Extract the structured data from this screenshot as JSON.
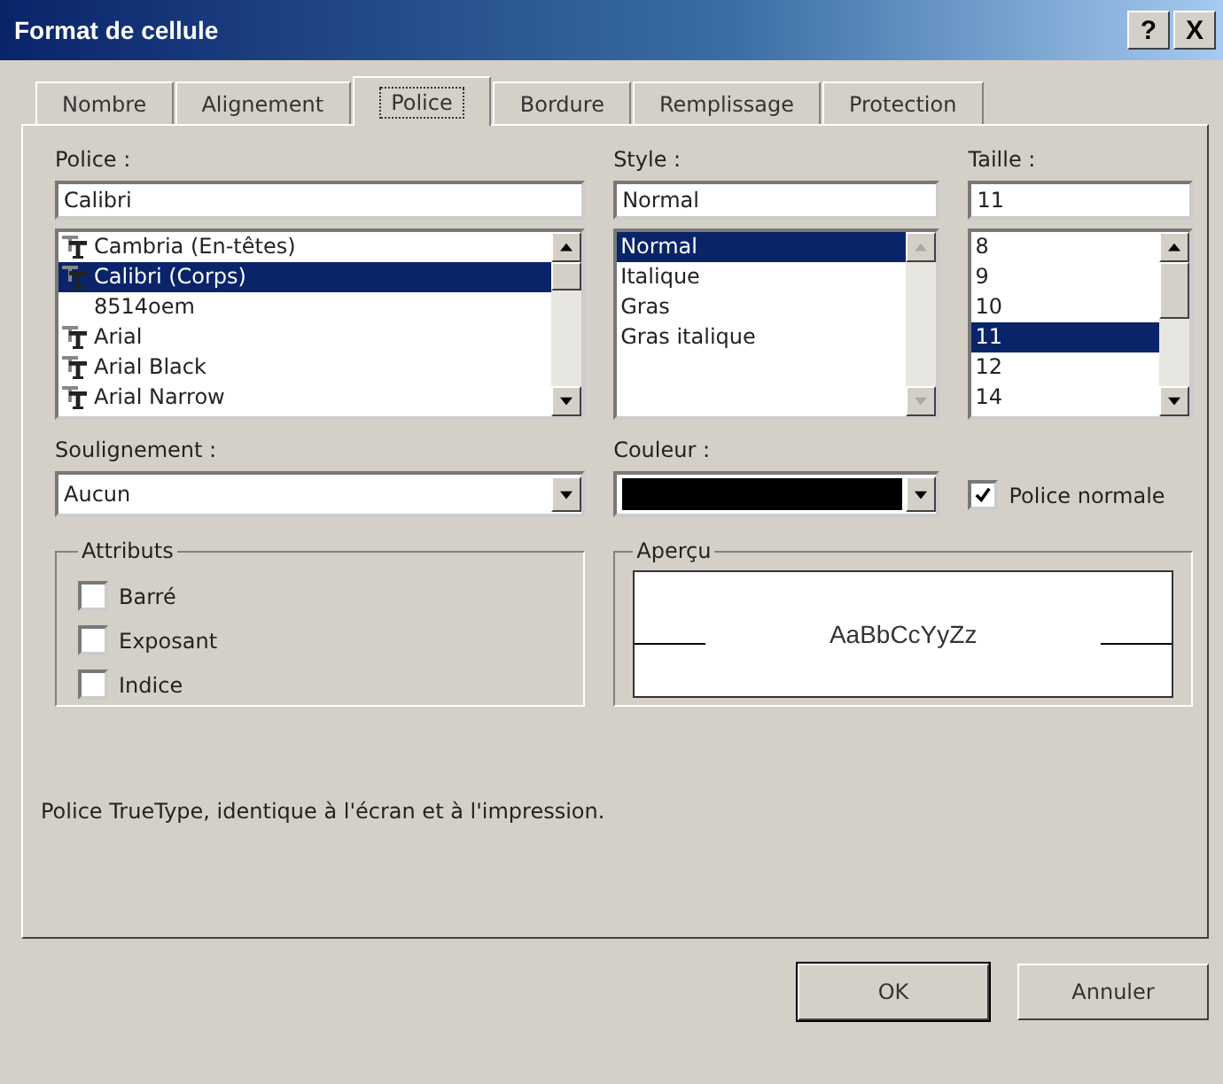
{
  "window": {
    "title": "Format de cellule",
    "help": "?",
    "close": "X"
  },
  "tabs": [
    {
      "label": "Nombre",
      "selected": false
    },
    {
      "label": "Alignement",
      "selected": false
    },
    {
      "label": "Police",
      "selected": true
    },
    {
      "label": "Bordure",
      "selected": false
    },
    {
      "label": "Remplissage",
      "selected": false
    },
    {
      "label": "Protection",
      "selected": false
    }
  ],
  "font": {
    "label": "Police :",
    "value": "Calibri",
    "items": [
      {
        "name": "Cambria (En-têtes)",
        "truetype": true,
        "selected": false
      },
      {
        "name": "Calibri (Corps)",
        "truetype": true,
        "selected": true
      },
      {
        "name": "8514oem",
        "truetype": false,
        "selected": false
      },
      {
        "name": "Arial",
        "truetype": true,
        "selected": false
      },
      {
        "name": "Arial Black",
        "truetype": true,
        "selected": false
      },
      {
        "name": "Arial Narrow",
        "truetype": true,
        "selected": false
      }
    ]
  },
  "style": {
    "label": "Style :",
    "value": "Normal",
    "items": [
      {
        "name": "Normal",
        "selected": true
      },
      {
        "name": "Italique",
        "selected": false
      },
      {
        "name": "Gras",
        "selected": false
      },
      {
        "name": "Gras italique",
        "selected": false
      }
    ]
  },
  "size": {
    "label": "Taille :",
    "value": "11",
    "items": [
      {
        "name": "8",
        "selected": false
      },
      {
        "name": "9",
        "selected": false
      },
      {
        "name": "10",
        "selected": false
      },
      {
        "name": "11",
        "selected": true
      },
      {
        "name": "12",
        "selected": false
      },
      {
        "name": "14",
        "selected": false
      }
    ]
  },
  "underline": {
    "label": "Soulignement :",
    "value": "Aucun"
  },
  "color": {
    "label": "Couleur :",
    "color": "#000000"
  },
  "normal_font": {
    "label": "Police normale",
    "checked": true
  },
  "attributes": {
    "title": "Attributs",
    "items": [
      {
        "label": "Barré",
        "checked": false
      },
      {
        "label": "Exposant",
        "checked": false
      },
      {
        "label": "Indice",
        "checked": false
      }
    ]
  },
  "preview": {
    "title": "Aperçu",
    "sample": "AaBbCcYyZz"
  },
  "note": "Police TrueType, identique à l'écran et à l'impression.",
  "buttons": [
    "OK",
    "Annuler"
  ]
}
